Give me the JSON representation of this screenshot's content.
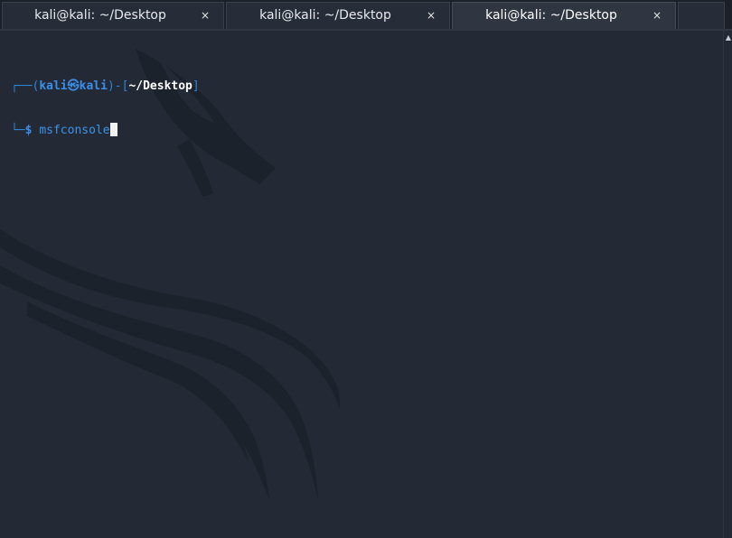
{
  "tabs": [
    {
      "title": "kali@kali: ~/Desktop",
      "close_glyph": "×",
      "active": false
    },
    {
      "title": "kali@kali: ~/Desktop",
      "close_glyph": "×",
      "active": false
    },
    {
      "title": "kali@kali: ~/Desktop",
      "close_glyph": "×",
      "active": true
    }
  ],
  "terminal": {
    "prompt": {
      "top_left_corner": "┌──(",
      "user": "kali",
      "separator_symbol": "㉿",
      "host": "kali",
      "bracket_join": ")-[",
      "path": "~/Desktop",
      "bracket_close": "]",
      "bottom_left_corner": "└─",
      "prompt_char": "$"
    },
    "command": "msfconsole",
    "background_image": "kali-dragon-logo"
  },
  "scrollbar": {
    "up_glyph": "▲"
  },
  "colors": {
    "background": "#232a35",
    "tabbar": "#1b2029",
    "prompt_blue": "#3b8ee8",
    "command_blue": "#3d94e6",
    "frame_blue": "#2c84d7",
    "path_white": "#ffffff",
    "dragon_shade": "#1a1f27"
  }
}
